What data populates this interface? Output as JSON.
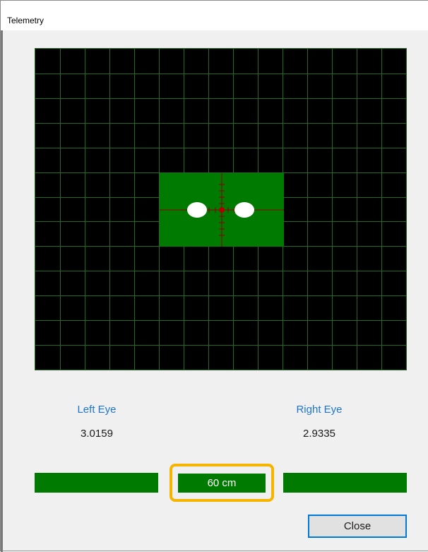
{
  "window": {
    "title": "Telemetry"
  },
  "telemetry": {
    "left_eye_label": "Left Eye",
    "left_eye_value": "3.0159",
    "right_eye_label": "Right Eye",
    "right_eye_value": "2.9335",
    "distance": "60 cm"
  },
  "buttons": {
    "close_label": "Close"
  },
  "colors": {
    "grid_background": "#000000",
    "grid_line": "#1f6b1f",
    "tracking_box": "#007a00",
    "crosshair": "#8b0000",
    "eye_marker": "#ffffff",
    "label_blue": "#1f76c9",
    "distance_highlight": "#f5b400",
    "button_border": "#0078d7"
  }
}
